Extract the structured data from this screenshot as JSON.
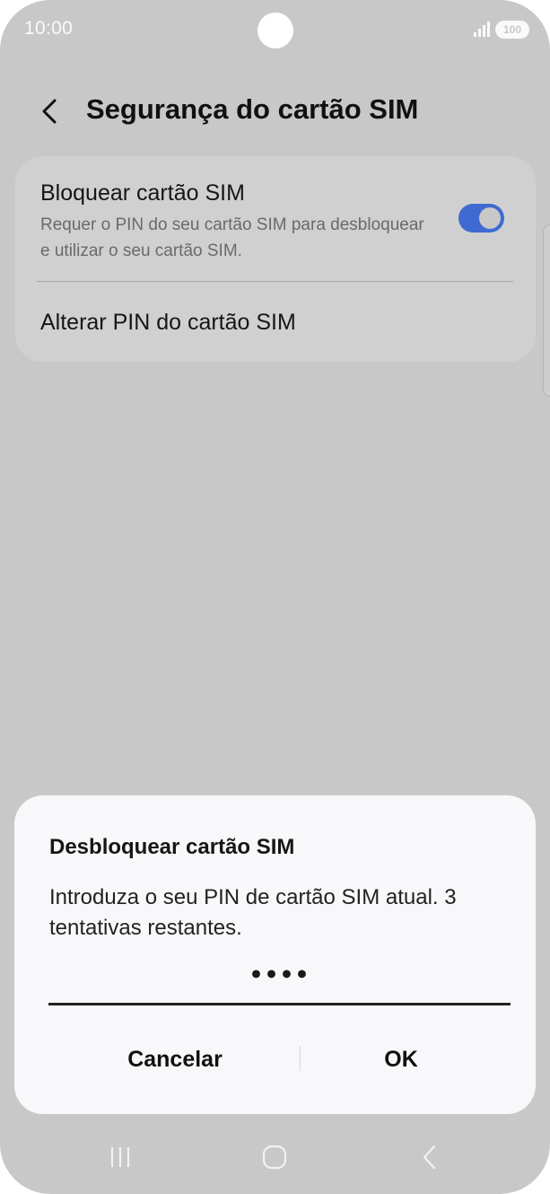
{
  "status_bar": {
    "time": "10:00",
    "battery": "100",
    "icons": [
      "signal-icon",
      "battery-icon"
    ]
  },
  "header": {
    "back_icon": "chevron-left-icon",
    "title": "Segurança do cartão SIM"
  },
  "settings": {
    "lock_sim": {
      "title": "Bloquear cartão SIM",
      "description": "Requer o PIN do seu cartão SIM para desbloquear e utilizar o seu cartão SIM.",
      "enabled": true
    },
    "change_pin": {
      "label": "Alterar PIN do cartão SIM"
    }
  },
  "dialog": {
    "title": "Desbloquear cartão SIM",
    "message": "Introduza o seu PIN de cartão SIM atual. 3 tentativas restantes.",
    "pin_value": "••••",
    "cancel_label": "Cancelar",
    "ok_label": "OK"
  },
  "nav_bar": {
    "icons": [
      "recent-apps-icon",
      "home-icon",
      "back-icon"
    ]
  },
  "colors": {
    "accent": "#3e6ad2",
    "scrim_background": "#c8c8c9",
    "dialog_background": "#f8f8fa"
  }
}
